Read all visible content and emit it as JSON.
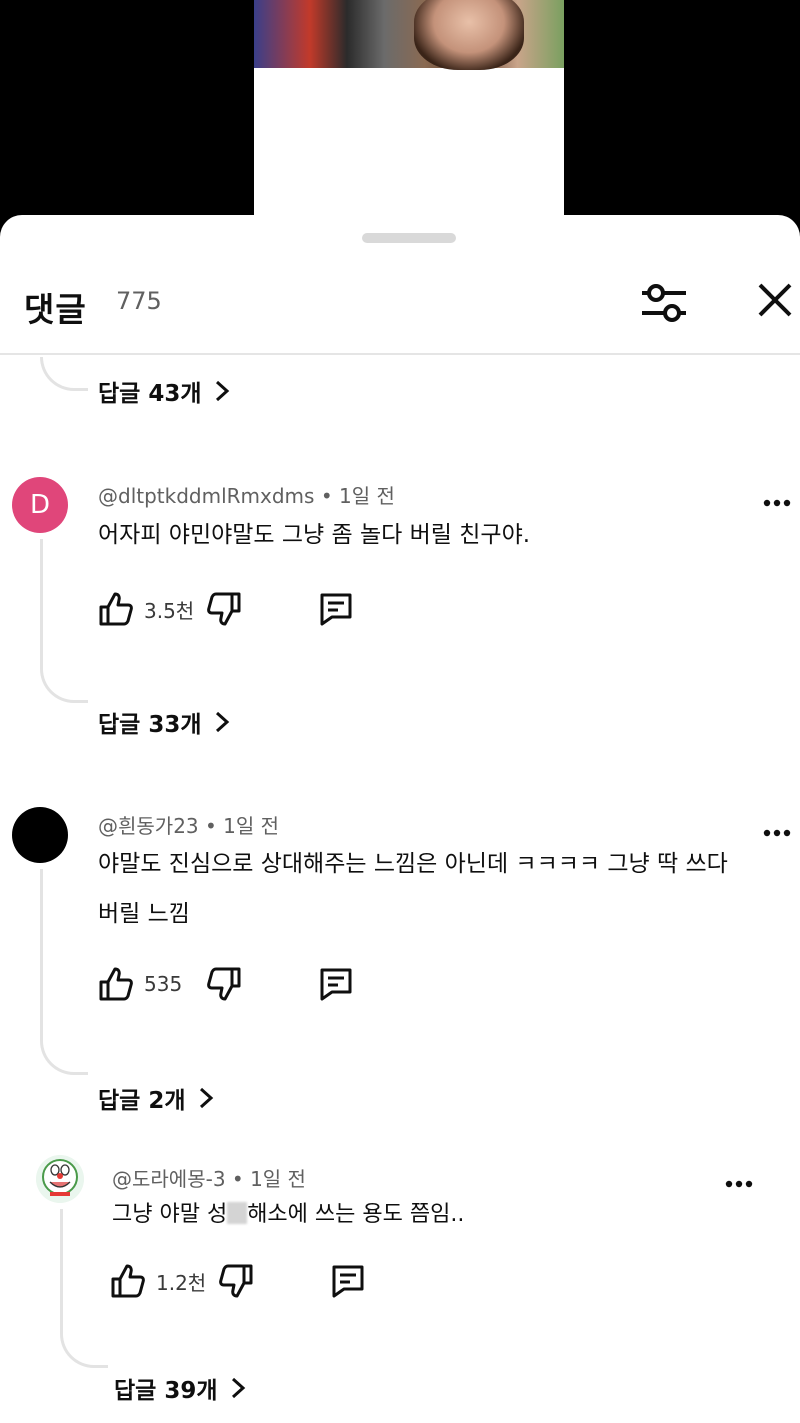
{
  "header": {
    "title": "댓글",
    "count": "775"
  },
  "replies_top": {
    "label": "답글 43개"
  },
  "comments": [
    {
      "avatar_letter": "D",
      "author": "@dltptkddmlRmxdms",
      "time": "1일 전",
      "text_lines": [
        "어자피 야민야말도 그냥 좀 놀다 버릴 친구야."
      ],
      "likes": "3.5천",
      "replies_label": "답글 33개"
    },
    {
      "author": "@흰동가23",
      "time": "1일 전",
      "text_lines": [
        "야말도 진심으로 상대해주는 느낌은 아닌데 ㅋㅋㅋㅋ 그냥 딱 쓰다",
        "버릴 느낌"
      ],
      "likes": "535",
      "replies_label": "답글 2개"
    },
    {
      "author": "@도라에몽-3",
      "time": "1일 전",
      "text_before": "그냥 야말 성",
      "text_after": "해소에 쓰는 용도 쯤임..",
      "likes": "1.2천",
      "replies_label": "답글 39개"
    }
  ],
  "icons": {
    "filter": "sliders-icon",
    "close": "close-icon",
    "like": "thumbs-up-icon",
    "dislike": "thumbs-down-icon",
    "reply": "comment-icon",
    "more": "more-vertical-dots-icon",
    "chevron": "chevron-right-icon"
  },
  "colors": {
    "avatar_d": "#e0467a",
    "meta_text": "#606060",
    "thread_line": "#e3e3e3"
  }
}
